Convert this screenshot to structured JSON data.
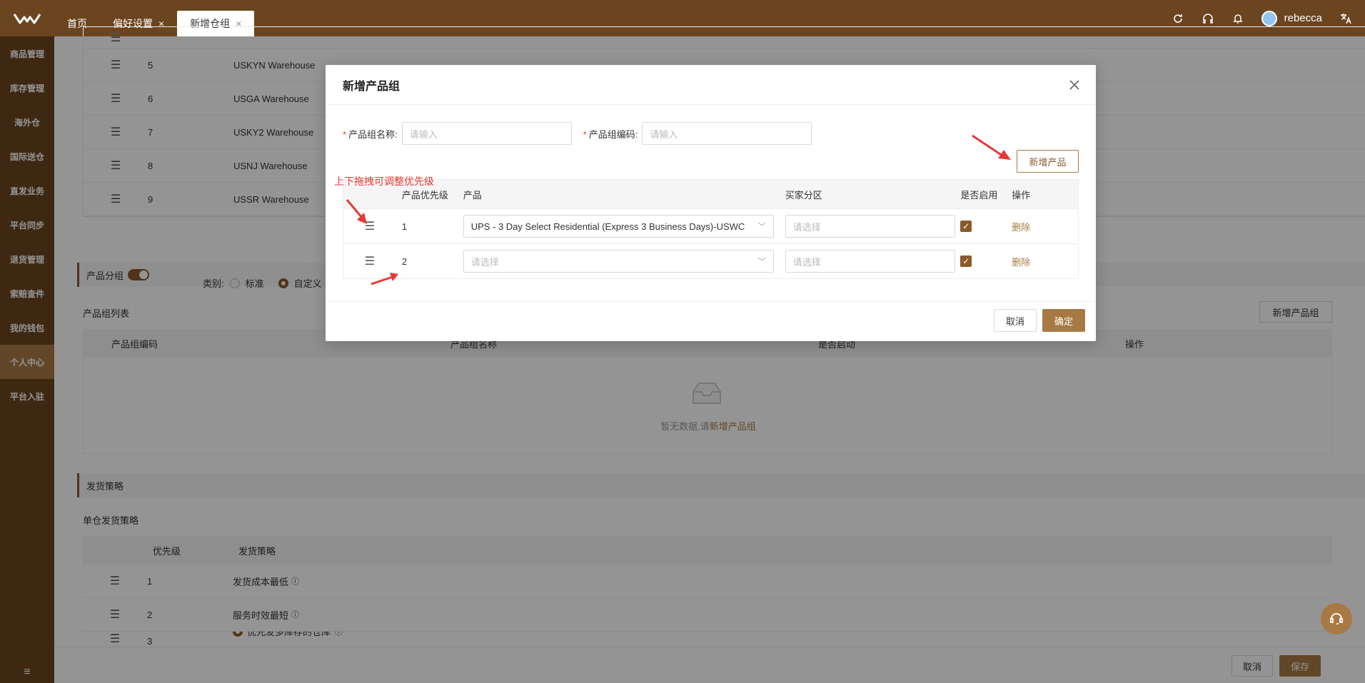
{
  "topbar": {
    "tabs": [
      {
        "label": "首页"
      },
      {
        "label": "偏好设置",
        "close": "×"
      },
      {
        "label": "新增仓组",
        "close": "×"
      }
    ],
    "username": "rebecca"
  },
  "sidebar": {
    "items": [
      "商品管理",
      "库存管理",
      "海外仓",
      "国际送仓",
      "直发业务",
      "平台同步",
      "退货管理",
      "索赔查件",
      "我的钱包",
      "个人中心",
      "平台入驻"
    ],
    "active_index": 9,
    "collapse_icon": "≡"
  },
  "background": {
    "warehouses": [
      {
        "num": "5",
        "name": "USKYN Warehouse"
      },
      {
        "num": "6",
        "name": "USGA Warehouse"
      },
      {
        "num": "7",
        "name": "USKY2 Warehouse"
      },
      {
        "num": "8",
        "name": "USNJ Warehouse"
      },
      {
        "num": "9",
        "name": "USSR Warehouse"
      }
    ],
    "product_group_section": "产品分组",
    "category_label": "类别:",
    "category_opt1": "标准",
    "category_opt2": "自定义",
    "product_group_list": "产品组列表",
    "add_group_button": "新增产品组",
    "list_headers": [
      "产品组编码",
      "产品组名称",
      "是否启动",
      "操作"
    ],
    "empty_text": "暂无数据,请",
    "empty_link": "新增产品组",
    "shipping_section": "发货策略",
    "single_wh_strategy": "单仓发货策略",
    "strategy_headers": [
      "优先级",
      "发货策略"
    ],
    "strategies": [
      {
        "num": "1",
        "label": "发货成本最低"
      },
      {
        "num": "2",
        "label": "服务时效最短"
      },
      {
        "num": "3",
        "label": "优先发多库存的仓库"
      }
    ],
    "cancel": "取消",
    "save": "保存"
  },
  "modal": {
    "title": "新增产品组",
    "name_label": "产品组名称:",
    "name_placeholder": "请输入",
    "code_label": "产品组编码:",
    "code_placeholder": "请输入",
    "add_product_button": "新增产品",
    "headers": [
      "产品优先级",
      "产品",
      "买家分区",
      "是否启用",
      "操作"
    ],
    "rows": [
      {
        "priority": "1",
        "product": "UPS - 3 Day Select Residential (Express 3 Business Days)-USWC",
        "zone_placeholder": "请选择",
        "enabled": true,
        "action": "删除"
      },
      {
        "priority": "2",
        "product_placeholder": "请选择",
        "zone_placeholder": "请选择",
        "enabled": true,
        "action": "删除"
      }
    ],
    "cancel": "取消",
    "confirm": "确定"
  },
  "annotation": {
    "drag_hint": "上下拖拽可调整优先级"
  },
  "colors": {
    "brand": "#6b4520",
    "accent": "#a77a45",
    "annotation": "#e53935"
  }
}
